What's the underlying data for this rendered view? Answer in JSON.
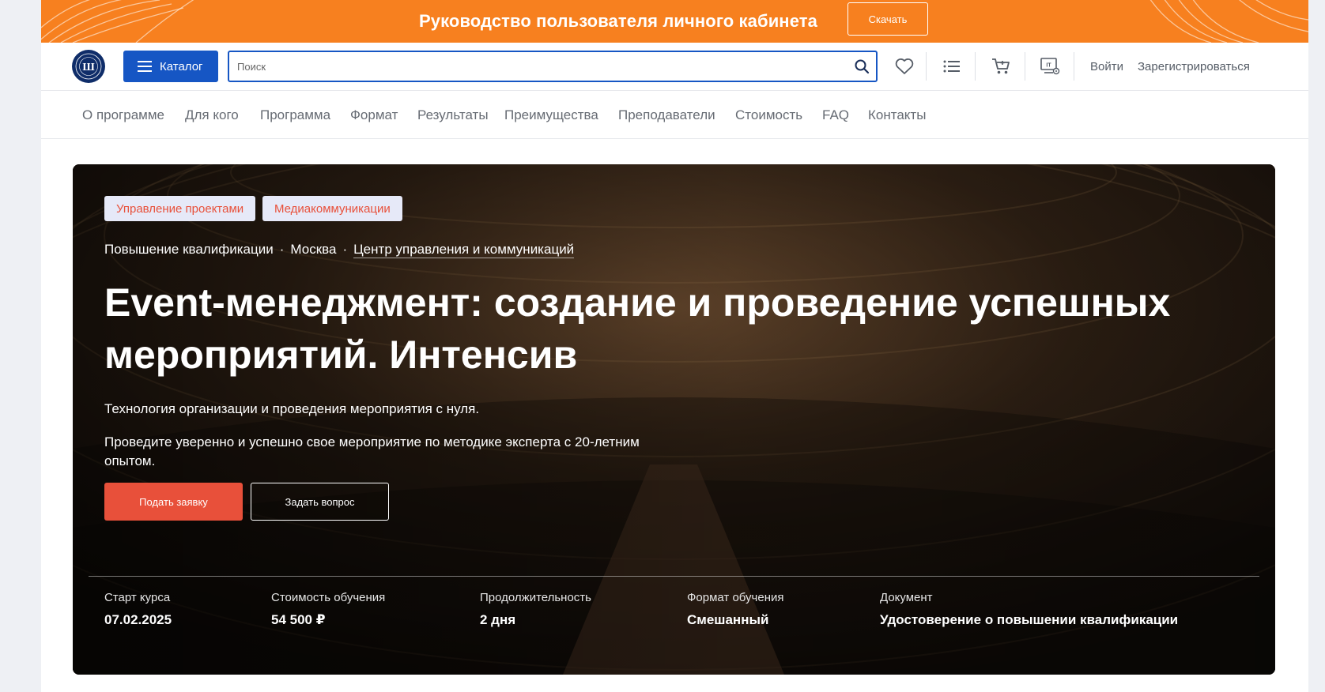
{
  "banner": {
    "title": "Руководство пользователя личного кабинета",
    "button_label": "Скачать"
  },
  "header": {
    "logo_icon": "hse-logo-icon",
    "catalog_label": "Каталог",
    "search_placeholder": "Поиск",
    "search_value": "",
    "icons": [
      "heart-icon",
      "list-icon",
      "cart-icon",
      "it-computer-icon"
    ],
    "login_label": "Войти",
    "register_label": "Зарегистрироваться"
  },
  "section_nav": [
    "О программе",
    "Для кого",
    "Программа",
    "Формат",
    "Результаты",
    "Преимущества",
    "Преподаватели",
    "Стоимость",
    "FAQ",
    "Контакты"
  ],
  "hero": {
    "tags": [
      "Управление проектами",
      "Медиакоммуникации"
    ],
    "breadcrumbs": [
      "Повышение квалификации",
      "Москва",
      "Центр управления и коммуникаций"
    ],
    "title": "Event-менеджмент: создание и проведение успешных мероприятий. Интенсив",
    "paragraph_1": "Технология организации и проведения мероприятия с нуля.",
    "paragraph_2": "Проведите уверенно и успешно свое мероприятие по методике эксперта с 20-летним опытом.",
    "apply_label": "Подать заявку",
    "ask_label": "Задать вопрос",
    "facts": [
      {
        "label": "Старт курса",
        "value": "07.02.2025"
      },
      {
        "label": "Стоимость обучения",
        "value": "54 500 ₽"
      },
      {
        "label": "Продолжительность",
        "value": "2 дня"
      },
      {
        "label": "Формат обучения",
        "value": "Смешанный"
      },
      {
        "label": "Документ",
        "value": "Удостоверение о повышении квалификации"
      }
    ]
  },
  "colors": {
    "banner": "#f7801f",
    "primary": "#1656c4",
    "accent": "#e8503a",
    "tag_bg": "#e6e9f8"
  }
}
